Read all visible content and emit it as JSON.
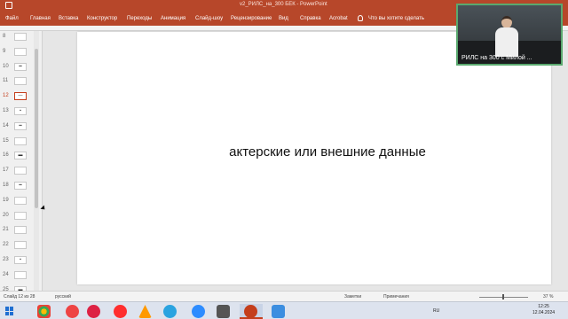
{
  "window": {
    "title": "v2_РИЛС_на_300 БЕК  -  PowerPoint"
  },
  "ribbon": {
    "tabs": [
      "Файл",
      "Главная",
      "Вставка",
      "Конструктор",
      "Переходы",
      "Анимация",
      "Слайд-шоу",
      "Рецензирование",
      "Вид",
      "Справка",
      "Acrobat"
    ],
    "tell_me": "Что вы хотите сделать"
  },
  "slides_panel": {
    "items": [
      {
        "number": "8",
        "thumb": ""
      },
      {
        "number": "9",
        "thumb": ""
      },
      {
        "number": "10",
        "thumb": "▪▪"
      },
      {
        "number": "11",
        "thumb": ""
      },
      {
        "number": "12",
        "thumb": "—"
      },
      {
        "number": "13",
        "thumb": "▪"
      },
      {
        "number": "14",
        "thumb": "▪▪"
      },
      {
        "number": "15",
        "thumb": ""
      },
      {
        "number": "16",
        "thumb": "▬"
      },
      {
        "number": "17",
        "thumb": ""
      },
      {
        "number": "18",
        "thumb": "▪▪"
      },
      {
        "number": "19",
        "thumb": ""
      },
      {
        "number": "20",
        "thumb": ""
      },
      {
        "number": "21",
        "thumb": ""
      },
      {
        "number": "22",
        "thumb": ""
      },
      {
        "number": "23",
        "thumb": "▪"
      },
      {
        "number": "24",
        "thumb": ""
      },
      {
        "number": "25",
        "thumb": "▬"
      }
    ],
    "active_slide": "12"
  },
  "slide": {
    "text": "актерские или внешние данные"
  },
  "webcam": {
    "caption": "РИЛС на 300 с Милой ..."
  },
  "statusbar": {
    "slide_info": "Слайд 12 из 28",
    "language": "русский",
    "notes": "Заметки",
    "comments": "Примечания",
    "zoom": "37 %"
  },
  "taskbar": {
    "lang": "RU",
    "time": "12:25",
    "date": "12.04.2024"
  },
  "colors": {
    "accent": "#b7472a",
    "active_border": "#c43e1c"
  }
}
